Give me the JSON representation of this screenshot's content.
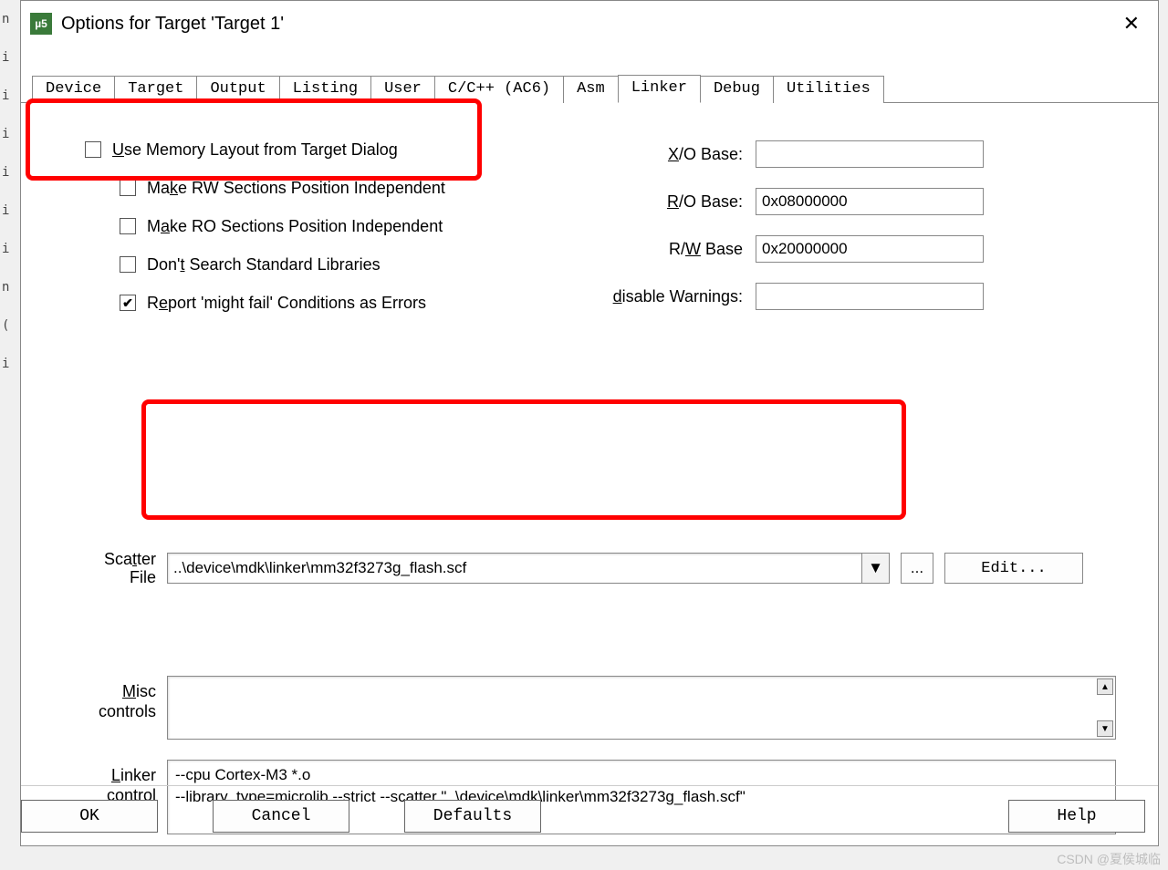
{
  "window": {
    "title": "Options for Target 'Target 1'",
    "icon_text": "µ5"
  },
  "tabs": [
    "Device",
    "Target",
    "Output",
    "Listing",
    "User",
    "C/C++ (AC6)",
    "Asm",
    "Linker",
    "Debug",
    "Utilities"
  ],
  "active_tab": "Linker",
  "checkboxes": {
    "use_memory_layout": {
      "label_pre": "U",
      "label_post": "se Memory Layout from Target Dialog",
      "checked": false
    },
    "make_rw": {
      "label": "Make RW Sections Position Independent",
      "checked": false,
      "accel": "k"
    },
    "make_ro": {
      "label": "Make RO Sections Position Independent",
      "checked": false,
      "accel": "a"
    },
    "dont_search": {
      "label": "Don't Search Standard Libraries",
      "checked": false,
      "accel": "t"
    },
    "report_might_fail": {
      "label": "Report 'might fail' Conditions as Errors",
      "checked": true,
      "accel": "e"
    }
  },
  "fields": {
    "xo_base": {
      "label_pre": "X",
      "label_post": "/O Base:",
      "value": ""
    },
    "ro_base": {
      "label_pre": "R",
      "label_post": "/O Base:",
      "value": "0x08000000"
    },
    "rw_base": {
      "label_pre": "R/",
      "label_accel": "W",
      "label_post": " Base",
      "value": "0x20000000"
    },
    "disable_warnings": {
      "label_pre": "d",
      "label_post": "isable Warnings:",
      "value": ""
    }
  },
  "scatter": {
    "label": "Scatter File",
    "accel": "t",
    "value": "..\\device\\mdk\\linker\\mm32f3273g_flash.scf",
    "browse": "...",
    "edit": "Edit..."
  },
  "misc": {
    "label": "Misc controls",
    "accel": "M",
    "value": ""
  },
  "linker_string": {
    "label": "Linker control string",
    "accel": "L",
    "value": "--cpu Cortex-M3 *.o\n--library_type=microlib --strict --scatter \"..\\device\\mdk\\linker\\mm32f3273g_flash.scf\""
  },
  "buttons": {
    "ok": "OK",
    "cancel": "Cancel",
    "defaults": "Defaults",
    "help": "Help"
  },
  "watermark": "CSDN @夏侯城临"
}
